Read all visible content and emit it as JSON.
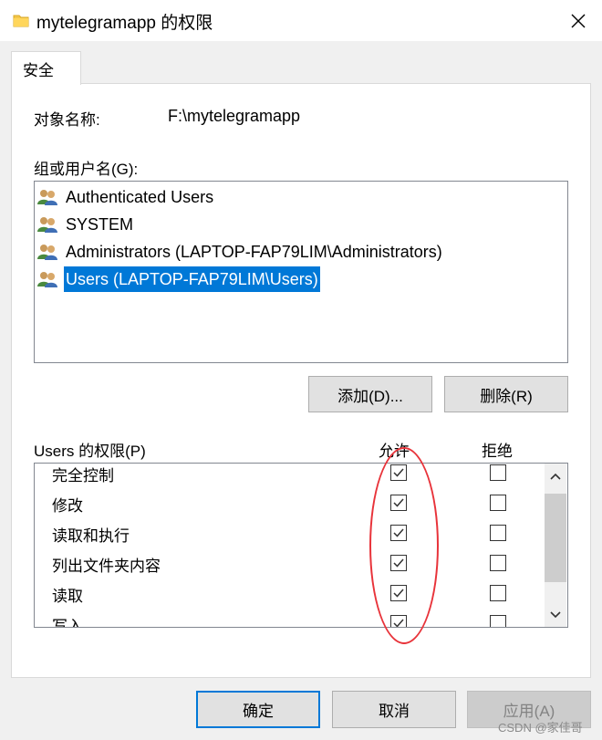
{
  "window": {
    "title": "mytelegramapp 的权限",
    "icon": "folder-icon",
    "close_icon": "close-icon"
  },
  "tabs": [
    {
      "label": "安全"
    }
  ],
  "object": {
    "label": "对象名称:",
    "value": "F:\\mytelegramapp"
  },
  "groups": {
    "label": "组或用户名(G):",
    "items": [
      {
        "name": "Authenticated Users",
        "icon": "users-group-icon",
        "selected": false
      },
      {
        "name": "SYSTEM",
        "icon": "users-group-icon",
        "selected": false
      },
      {
        "name": "Administrators (LAPTOP-FAP79LIM\\Administrators)",
        "icon": "users-group-icon",
        "selected": false
      },
      {
        "name": "Users (LAPTOP-FAP79LIM\\Users)",
        "icon": "users-group-icon",
        "selected": true
      }
    ],
    "add_button": "添加(D)...",
    "remove_button": "删除(R)"
  },
  "permissions": {
    "label": "Users 的权限(P)",
    "allow_header": "允许",
    "deny_header": "拒绝",
    "rows": [
      {
        "name": "完全控制",
        "allow": true,
        "deny": false
      },
      {
        "name": "修改",
        "allow": true,
        "deny": false
      },
      {
        "name": "读取和执行",
        "allow": true,
        "deny": false
      },
      {
        "name": "列出文件夹内容",
        "allow": true,
        "deny": false
      },
      {
        "name": "读取",
        "allow": true,
        "deny": false
      },
      {
        "name": "写入",
        "allow": true,
        "deny": false
      }
    ]
  },
  "buttons": {
    "ok": "确定",
    "cancel": "取消",
    "apply": "应用(A)"
  },
  "annotation": {
    "color": "#e8333a"
  },
  "watermark": "CSDN @家佳哥",
  "colors": {
    "selection": "#0078d7",
    "dialog_bg": "#f0f0f0"
  }
}
